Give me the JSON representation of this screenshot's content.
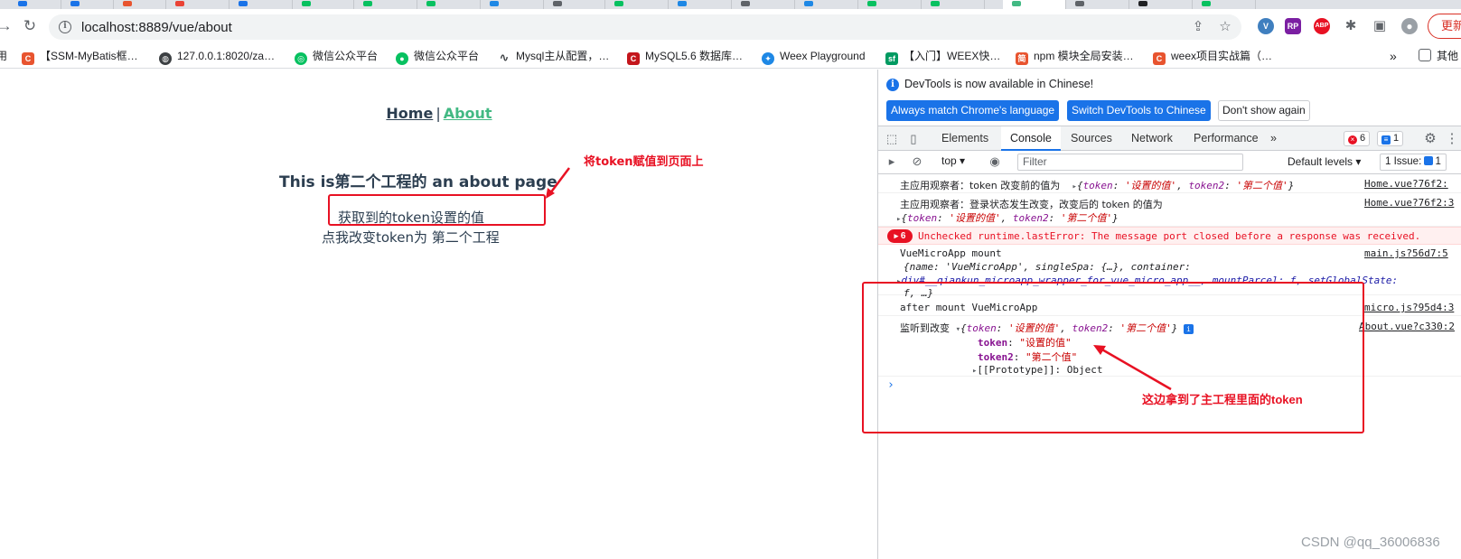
{
  "browser": {
    "url": "localhost:8889/vue/about",
    "update_label": "更新"
  },
  "bookmarks": [
    {
      "label": "用",
      "color": "#5f6368"
    },
    {
      "label": "【SSM-MyBatis框…",
      "color": "#e8542f"
    },
    {
      "label": "127.0.0.1:8020/za…",
      "color": "#3c4043"
    },
    {
      "label": "微信公众平台",
      "color": "#07c160"
    },
    {
      "label": "微信公众平台",
      "color": "#07c160"
    },
    {
      "label": "Mysql主从配置，…",
      "color": "#3c4043"
    },
    {
      "label": "MySQL5.6 数据库…",
      "color": "#c4161c"
    },
    {
      "label": "Weex Playground",
      "color": "#1e88e5"
    },
    {
      "label": "【入门】WEEX快…",
      "color": "#009a61"
    },
    {
      "label": "npm 模块全局安装…",
      "color": "#e8542f"
    },
    {
      "label": "weex项目实战篇（…",
      "color": "#e8542f"
    },
    {
      "label": "»",
      "color": "#5f6368"
    },
    {
      "label": "其他",
      "color": "#5f6368"
    }
  ],
  "page": {
    "nav_home": "Home",
    "nav_sep": "|",
    "nav_about": "About",
    "title": "This is第二个工程的 an about page",
    "token_line": "获取到的token设置的值",
    "change_button": "点我改变token为 第二个工程",
    "annotation_top": "将token赋值到页面上",
    "annotation_console": "这边拿到了主工程里面的token"
  },
  "devtools": {
    "banner_message": "DevTools is now available in Chinese!",
    "btn_match": "Always match Chrome's language",
    "btn_switch": "Switch DevTools to Chinese",
    "btn_dismiss": "Don't show again",
    "tabs": [
      "Elements",
      "Console",
      "Sources",
      "Network",
      "Performance"
    ],
    "more_tabs": "»",
    "error_count": "6",
    "message_count": "1",
    "context": "top ▾",
    "filter_placeholder": "Filter",
    "levels": "Default levels ▾",
    "issues": "1 Issue: ",
    "issues_count": "1"
  },
  "console": {
    "row1_label": "主应用观察者：token 改变前的值为",
    "row1_src": "Home.vue?76f2:",
    "row2_label": "主应用观察者：登录状态发生改变，改变后的 token 的值为",
    "row2_src": "Home.vue?76f2:3",
    "error_badge": "6",
    "error_text": "Unchecked runtime.lastError: The message port closed before a response was received.",
    "mount_label": "VueMicroApp mount",
    "mount_src": "main.js?56d7:5",
    "after_mount": "after mount VueMicroApp",
    "after_src": "micro.js?95d4:3",
    "listen_label": "监听到改变",
    "listen_src": "About.vue?c330:2",
    "token_key": "token",
    "token_val": "\"设置的值\"",
    "token2_key": "token2",
    "token2_val": "\"第二个值\"",
    "proto": "[[Prototype]]: Object",
    "obj_token": "'设置的值'",
    "obj_token2": "'第二个值'",
    "mount_obj_line1": "{name: 'VueMicroApp', singleSpa: {…}, container:",
    "mount_obj_line2": "div#__qiankun_microapp_wrapper_for_vue_micro_app__, mountParcel: f, setGlobalState:",
    "mount_obj_line3": "f, …}"
  },
  "watermark": "CSDN @qq_36006836"
}
